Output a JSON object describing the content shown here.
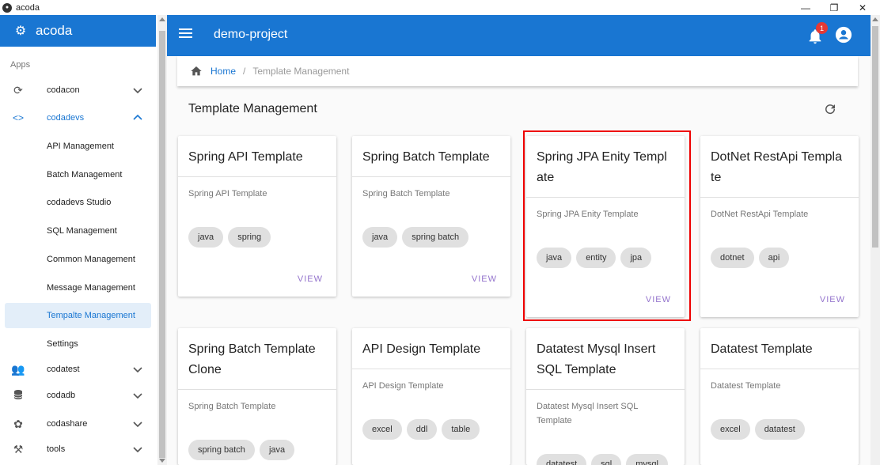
{
  "window": {
    "title": "acoda",
    "controls": [
      "—",
      "❐",
      "✕"
    ]
  },
  "sidebar": {
    "brand": "acoda",
    "section_label": "Apps",
    "groups": [
      {
        "label": "codacon",
        "icon": "sync-icon"
      },
      {
        "label": "codadevs",
        "icon": "code-icon",
        "expanded": true
      },
      {
        "label": "codatest",
        "icon": "people-settings-icon"
      },
      {
        "label": "codadb",
        "icon": "database-icon"
      },
      {
        "label": "codashare",
        "icon": "share-icon"
      },
      {
        "label": "tools",
        "icon": "tools-icon"
      }
    ],
    "sub_items": [
      {
        "label": "API Management"
      },
      {
        "label": "Batch Management"
      },
      {
        "label": "codadevs Studio"
      },
      {
        "label": "SQL Management"
      },
      {
        "label": "Common Management"
      },
      {
        "label": "Message Management"
      },
      {
        "label": "Tempalte Management",
        "selected": true
      },
      {
        "label": "Settings"
      }
    ]
  },
  "appbar": {
    "project": "demo-project",
    "notification_count": "1"
  },
  "breadcrumb": {
    "home": "Home",
    "separator": "/",
    "current": "Template Management"
  },
  "page": {
    "title": "Template Management"
  },
  "cards": [
    {
      "title": "Spring API Template",
      "description": "Spring API Template",
      "tags": [
        "java",
        "spring"
      ],
      "action": "VIEW"
    },
    {
      "title": "Spring Batch Template",
      "description": "Spring Batch Template",
      "tags": [
        "java",
        "spring batch"
      ],
      "action": "VIEW"
    },
    {
      "title": "Spring JPA Enity Templ ate",
      "description": "Spring JPA Enity Template",
      "tags": [
        "java",
        "entity",
        "jpa"
      ],
      "action": "VIEW"
    },
    {
      "title": "DotNet RestApi Templa te",
      "description": "DotNet RestApi Template",
      "tags": [
        "dotnet",
        "api"
      ],
      "action": "VIEW"
    },
    {
      "title": "Spring Batch Template Clone",
      "description": "Spring Batch Template",
      "tags": [
        "spring batch",
        "java"
      ]
    },
    {
      "title": "API Design Template",
      "description": "API Design Template",
      "tags": [
        "excel",
        "ddl",
        "table"
      ]
    },
    {
      "title": "Datatest Mysql Insert SQL Template",
      "description": "Datatest Mysql Insert SQL Template",
      "tags": [
        "datatest",
        "sql",
        "mysql"
      ]
    },
    {
      "title": "Datatest Template",
      "description": "Datatest Template",
      "tags": [
        "excel",
        "datatest"
      ]
    }
  ],
  "colors": {
    "primary": "#1976d2",
    "badge": "#e53935",
    "action": "#9575cd",
    "highlight": "#e00000"
  }
}
